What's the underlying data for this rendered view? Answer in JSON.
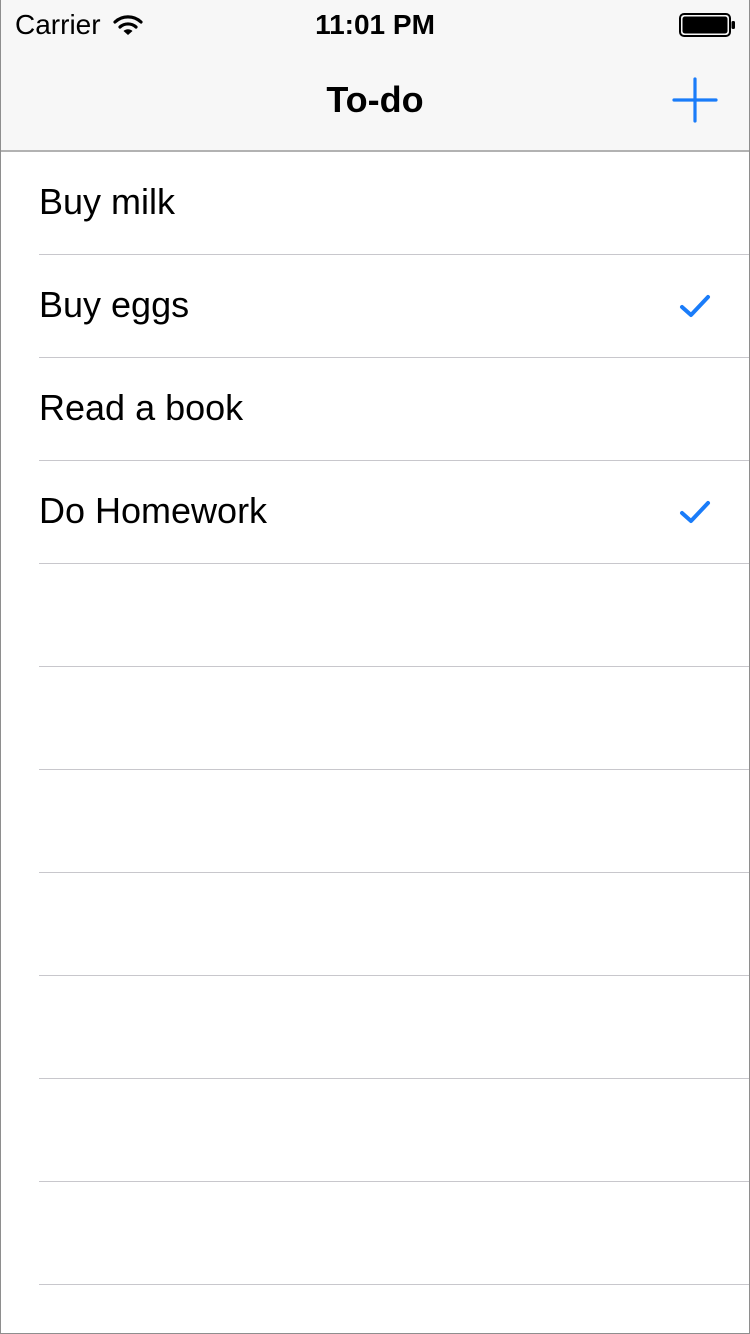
{
  "status_bar": {
    "carrier": "Carrier",
    "time": "11:01 PM",
    "wifi_icon": "wifi-icon",
    "battery_icon": "battery-full-icon"
  },
  "nav_bar": {
    "title": "To-do",
    "add_icon": "plus-icon"
  },
  "colors": {
    "accent": "#1a7cf9",
    "nav_background": "#f7f7f7",
    "separator": "#c8c7cc"
  },
  "todos": [
    {
      "label": "Buy milk",
      "checked": false
    },
    {
      "label": "Buy eggs",
      "checked": true
    },
    {
      "label": "Read a book",
      "checked": false
    },
    {
      "label": "Do Homework",
      "checked": true
    }
  ],
  "empty_rows": 7
}
